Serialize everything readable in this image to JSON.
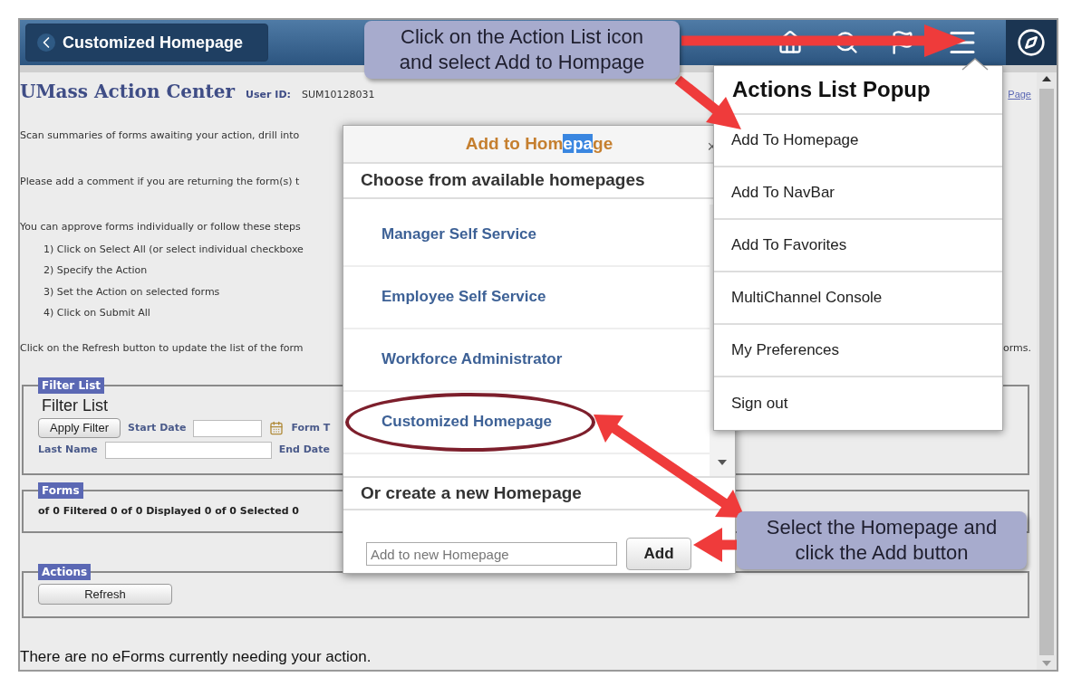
{
  "header": {
    "back_label": "Customized Homepage"
  },
  "page": {
    "title": "UMass Action Center",
    "user_id_label": "User ID:",
    "user_id": "SUM10128031",
    "top_link": "Page",
    "intro": [
      "Scan summaries of forms awaiting your action, drill into",
      "Please add a comment if you are returning the form(s) t"
    ],
    "steps_intro": "You can approve forms individually or follow these steps",
    "steps": [
      "1) Click on Select All (or select individual checkboxe",
      "2) Specify the Action",
      "3) Set the Action on selected forms",
      "4) Click on Submit All"
    ],
    "refresh_note": "Click on the Refresh button to update the list of the form",
    "refresh_note_end": "orms.",
    "filter": {
      "legend": "Filter List",
      "heading": "Filter List",
      "apply_button": "Apply Filter",
      "start_date_label": "Start Date",
      "form_label": "Form T",
      "last_name_label": "Last Name",
      "end_date_label": "End Date"
    },
    "forms": {
      "legend": "Forms",
      "summary": "of 0 Filtered 0 of 0 Displayed 0 of 0 Selected 0"
    },
    "actions": {
      "legend": "Actions",
      "refresh_button": "Refresh"
    },
    "empty_message": "There are no eForms currently needing your action."
  },
  "add_dialog": {
    "title": {
      "before": "Add to Hom",
      "selected": "epa",
      "after": "ge"
    },
    "close": "×",
    "choose_heading": "Choose from available homepages",
    "homepages": [
      {
        "label": "Manager Self Service",
        "circled": false
      },
      {
        "label": "Employee Self Service",
        "circled": false
      },
      {
        "label": "Workforce Administrator",
        "circled": false
      },
      {
        "label": "Customized Homepage",
        "circled": true
      }
    ],
    "create_heading": "Or create a new Homepage",
    "new_placeholder": "Add to new Homepage",
    "add_button": "Add"
  },
  "actions_popup": {
    "title": "Actions List Popup",
    "items": [
      "Add To Homepage",
      "Add To NavBar",
      "Add To Favorites",
      "MultiChannel Console",
      "My Preferences",
      "Sign out"
    ]
  },
  "callouts": [
    {
      "lines": [
        "Click on the Action List icon",
        "and select Add to Hompage"
      ]
    },
    {
      "lines": [
        "Select the Homepage and",
        "click the Add button"
      ]
    }
  ]
}
